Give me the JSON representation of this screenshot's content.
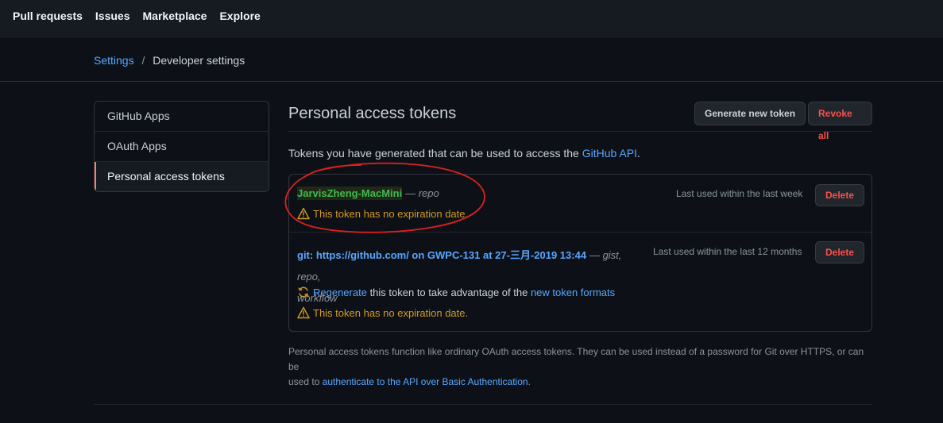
{
  "topnav": {
    "items": [
      "Pull requests",
      "Issues",
      "Marketplace",
      "Explore"
    ]
  },
  "breadcrumb": {
    "parent": "Settings",
    "separator": "/",
    "current": "Developer settings"
  },
  "sidebar": {
    "items": [
      "GitHub Apps",
      "OAuth Apps",
      "Personal access tokens"
    ],
    "active": "Personal access tokens"
  },
  "main": {
    "title": "Personal access tokens",
    "generate_label": "Generate new token",
    "revoke_label": "Revoke all",
    "intro_prefix": "Tokens you have generated that can be used to access the ",
    "intro_link": "GitHub API",
    "intro_suffix": "."
  },
  "tokens": [
    {
      "name": "JarvisZheng-MacMini",
      "scopes": "— repo",
      "last_used": "Last used within the last week",
      "delete_label": "Delete",
      "warning": "This token has no expiration date."
    },
    {
      "name": "git: https://github.com/ on GWPC-131 at 27-三月-2019 13:44",
      "scopes_line1": "— gist, repo,",
      "scopes_line2": "workflow",
      "last_used": "Last used within the last 12 months",
      "delete_label": "Delete",
      "regen_link": "Regenerate",
      "regen_middle": " this token to take advantage of the ",
      "regen_link2": "new token formats",
      "warning": "This token has no expiration date."
    }
  ],
  "footer": {
    "line1": "Personal access tokens function like ordinary OAuth access tokens. They can be used instead of a password for Git over HTTPS, or can be",
    "line2_prefix": "used to ",
    "line2_link": "authenticate to the API over Basic Authentication",
    "line2_suffix": "."
  },
  "colors": {
    "accent": "#58a6ff",
    "danger": "#f85149",
    "warning": "#d29922",
    "token_green": "#3fb950",
    "annotation": "#e0201e"
  },
  "icons": [
    "alert-triangle-icon",
    "sync-icon"
  ]
}
